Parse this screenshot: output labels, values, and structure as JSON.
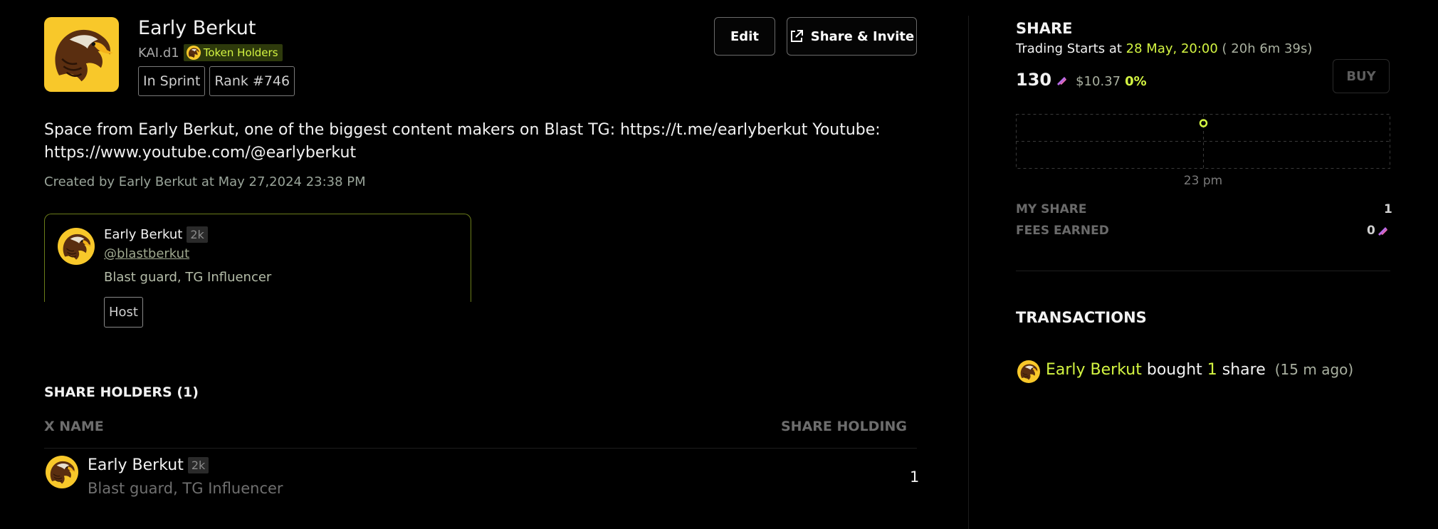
{
  "space": {
    "title": "Early Berkut",
    "handle": "KAI.d1",
    "token_badge": "Token Holders",
    "tags": [
      "In Sprint",
      "Rank #746"
    ],
    "description": "Space from Early Berkut, one of the biggest content makers on Blast TG: https://t.me/earlyberkut Youtube: https://www.youtube.com/@earlyberkut",
    "created": "Created by Early Berkut at May 27,2024 23:38 PM"
  },
  "actions": {
    "edit_label": "Edit",
    "share_label": "Share & Invite"
  },
  "host": {
    "name": "Early Berkut",
    "follower_count": "2k",
    "handle": "@blastberkut",
    "bio": "Blast guard, TG Influencer",
    "role": "Host"
  },
  "holders": {
    "title": "SHARE HOLDERS (1)",
    "col_name": "X NAME",
    "col_holding": "SHARE HOLDING",
    "rows": [
      {
        "name": "Early Berkut",
        "follower_count": "2k",
        "bio": "Blast guard, TG Influencer",
        "holding": "1"
      }
    ]
  },
  "share": {
    "heading": "SHARE",
    "trading_prefix": "Trading Starts at",
    "trading_time": "28 May, 20:00",
    "countdown": "( 20h 6m 39s)",
    "price": "130",
    "price_usd": "$10.37",
    "change": "0%",
    "buy_label": "BUY",
    "chart_tick": "23 pm",
    "my_share_label": "MY SHARE",
    "my_share_value": "1",
    "fees_label": "FEES EARNED",
    "fees_value": "0"
  },
  "transactions": {
    "heading": "TRANSACTIONS",
    "items": [
      {
        "user": "Early Berkut",
        "action": "bought",
        "amount": "1",
        "unit": "share",
        "ago": "(15 m ago)"
      }
    ]
  },
  "colors": {
    "accent": "#d4f542",
    "avatar_bg": "#f8c82a",
    "background": "#000000"
  }
}
